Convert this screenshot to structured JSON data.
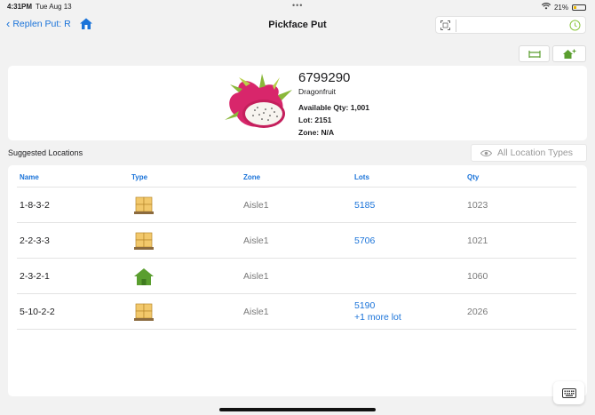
{
  "status_bar": {
    "time": "4:31PM",
    "date": "Tue Aug 13",
    "battery": "21%"
  },
  "nav": {
    "back_label": "Replen Put:  R",
    "title": "Pickface Put",
    "search_value": "",
    "search_placeholder": ""
  },
  "product": {
    "sku": "6799290",
    "name": "Dragonfruit",
    "available_qty": "Available Qty: 1,001",
    "lot": "Lot: 2151",
    "zone": "Zone: N/A"
  },
  "section": {
    "label": "Suggested Locations",
    "filter_label": "All Location Types"
  },
  "table": {
    "headers": [
      "Name",
      "Type",
      "Zone",
      "Lots",
      "Qty"
    ],
    "rows": [
      {
        "name": "1-8-3-2",
        "type": "pallet-icon",
        "zone": "Aisle1",
        "lots": [
          "5185"
        ],
        "qty": "1023"
      },
      {
        "name": "2-2-3-3",
        "type": "pallet-icon",
        "zone": "Aisle1",
        "lots": [
          "5706"
        ],
        "qty": "1021"
      },
      {
        "name": "2-3-2-1",
        "type": "home-location-icon",
        "zone": "Aisle1",
        "lots": [],
        "qty": "1060"
      },
      {
        "name": "5-10-2-2",
        "type": "pallet-icon",
        "zone": "Aisle1",
        "lots": [
          "5190",
          "+1 more lot"
        ],
        "qty": "2026"
      }
    ]
  },
  "colors": {
    "accent": "#1a73d9",
    "icon_green": "#5a9e2f",
    "background": "#f2f2f2"
  }
}
